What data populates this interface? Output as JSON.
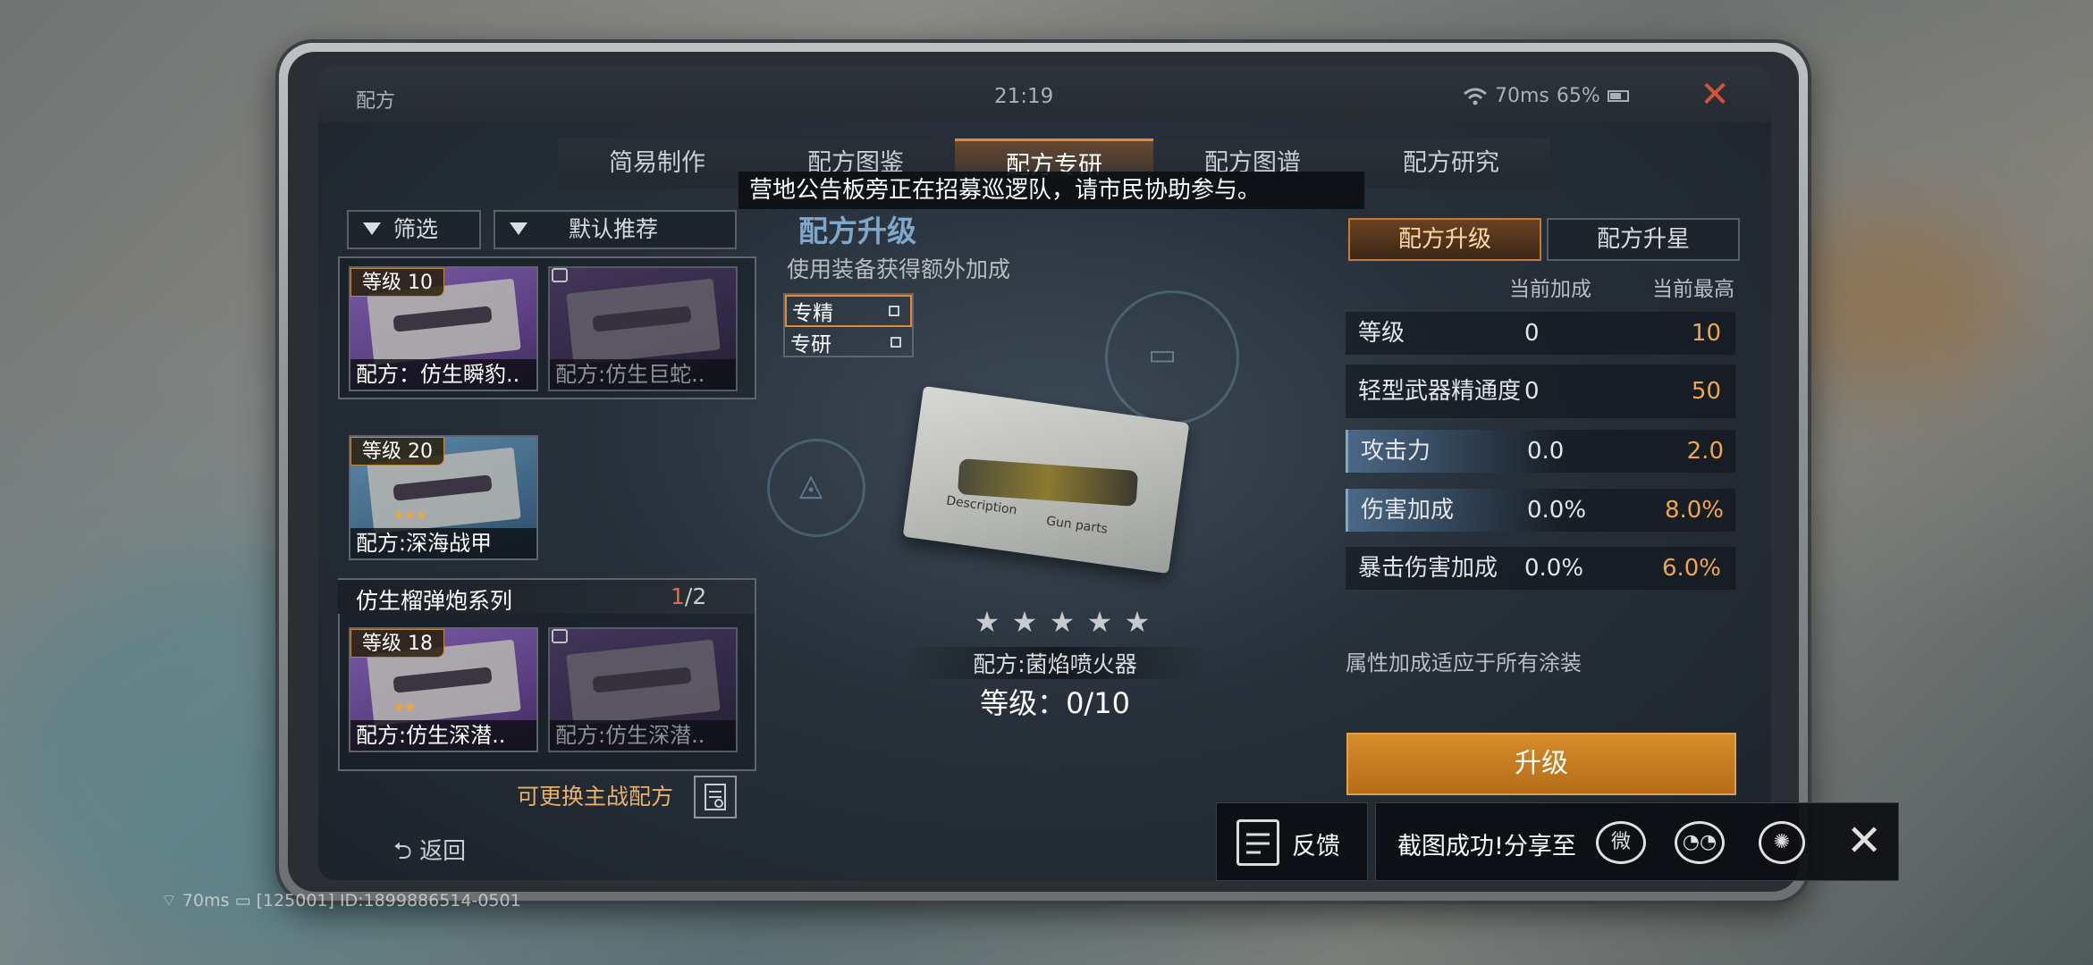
{
  "status_bar": {
    "title": "配方",
    "time": "21:19",
    "ping": "70ms",
    "battery": "65%"
  },
  "tabs": [
    {
      "label": "简易制作"
    },
    {
      "label": "配方图鉴"
    },
    {
      "label": "配方专研",
      "active": true
    },
    {
      "label": "配方图谱"
    },
    {
      "label": "配方研究"
    }
  ],
  "notice": "营地公告板旁正在招募巡逻队，请市民协助参与。",
  "left_panel": {
    "filter_label": "筛选",
    "sort_label": "默认推荐",
    "cards": [
      {
        "level": "等级 10",
        "name": "配方：仿生瞬豹..",
        "locked": false
      },
      {
        "level": "",
        "name": "配方:仿生巨蛇..",
        "locked": true
      },
      {
        "level": "等级 20",
        "name": "配方:深海战甲",
        "locked": false
      },
      {
        "level": "等级 18",
        "name": "配方:仿生深潜..",
        "locked": false
      },
      {
        "level": "",
        "name": "配方:仿生深潜..",
        "locked": true
      }
    ],
    "series": {
      "title": "仿生榴弹炮系列",
      "current": "1",
      "total": "/2"
    },
    "swap_label": "可更换主战配方",
    "back_label": "返回"
  },
  "center": {
    "title": "配方升级",
    "subtitle": "使用装备获得额外加成",
    "options": [
      {
        "label": "专精"
      },
      {
        "label": "专研"
      }
    ],
    "recipe_labels": {
      "a": "Description",
      "b": "Gun parts"
    },
    "stars": 5,
    "recipe_name": "配方:菌焰喷火器",
    "level_text": "等级：0/10"
  },
  "right_panel": {
    "tab_upgrade": "配方升级",
    "tab_star": "配方升星",
    "col_current": "当前加成",
    "col_max": "当前最高",
    "stats": [
      {
        "name": "等级",
        "current": "0",
        "max": "10",
        "highlight": false
      },
      {
        "name": "轻型武器精通度",
        "current": "0",
        "max": "50",
        "highlight": false
      },
      {
        "name": "攻击力",
        "current": "0.0",
        "max": "2.0",
        "highlight": true
      },
      {
        "name": "伤害加成",
        "current": "0.0%",
        "max": "8.0%",
        "highlight": true
      },
      {
        "name": "暴击伤害加成",
        "current": "0.0%",
        "max": "6.0%",
        "highlight": false
      }
    ],
    "note": "属性加成适应于所有涂装",
    "upgrade_button": "升级"
  },
  "share_bar": {
    "feedback_label": "反馈",
    "share_label": "截图成功!分享至",
    "icons": [
      "weibo-icon",
      "wechat-icon",
      "moments-icon"
    ]
  },
  "footer": {
    "ping": "70ms",
    "id_text": "[125001] ID:1899886514-0501"
  },
  "colors": {
    "accent": "#e38a32",
    "value_highlight": "#f0a54e",
    "title_blue": "#7fa7c9",
    "close_red": "#d2553b"
  }
}
